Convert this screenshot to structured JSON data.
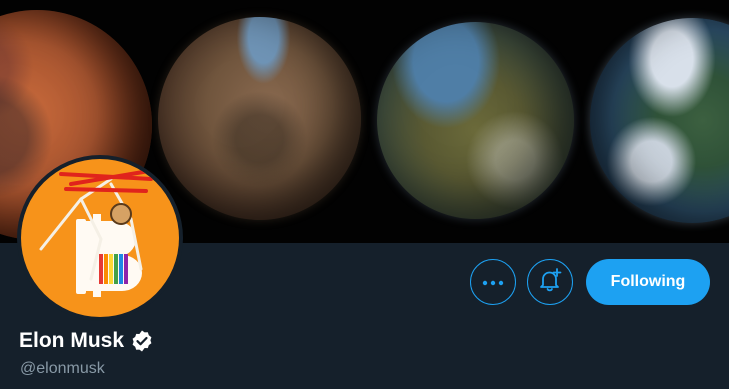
{
  "profile": {
    "display_name": "Elon Musk",
    "handle": "@elonmusk",
    "verified": true
  },
  "banner": {
    "description_icon": "terraforming-planets-image"
  },
  "actions": {
    "more_icon": "more-dots-icon",
    "notify_icon": "bell-plus-icon",
    "follow_label": "Following"
  },
  "colors": {
    "background": "#15202b",
    "accent": "#1da1f2",
    "text_primary": "#ffffff",
    "text_secondary": "#8899a6",
    "avatar_bg": "#f7931a"
  }
}
